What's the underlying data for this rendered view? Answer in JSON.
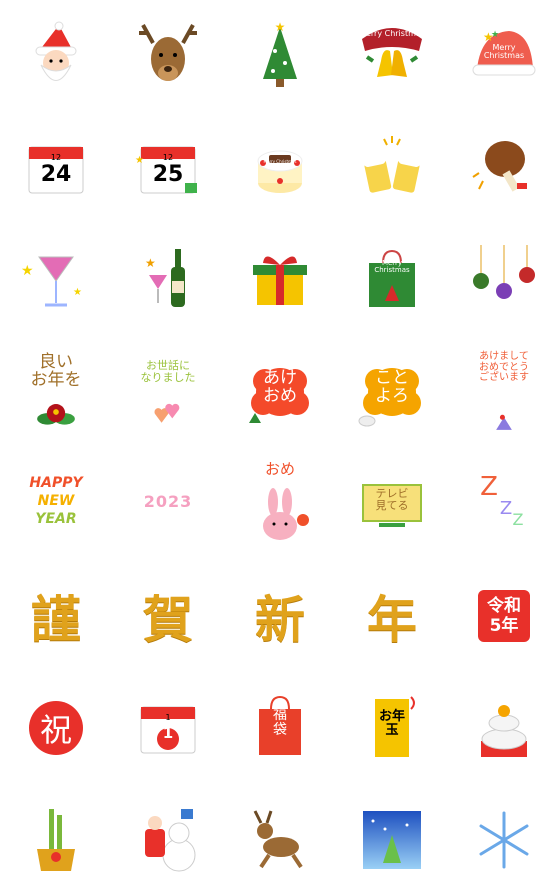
{
  "colors": {
    "red": "#e8302a",
    "gold": "#e0a21c",
    "green": "#2f8a34"
  },
  "stickers": {
    "r1": {
      "santa": "santa-icon",
      "reindeer": "reindeer-icon",
      "tree": "christmas-tree-icon",
      "bell_sign": "Merry Christmas",
      "santa_hat": "Merry Christmas"
    },
    "r2": {
      "cal24_month": "12",
      "cal24_day": "24",
      "cal25_month": "12",
      "cal25_day": "25",
      "cake": "Merry Christmas",
      "beer": "beer-toast-icon",
      "chicken": "chicken-leg-icon"
    },
    "r3": {
      "cocktail": "cocktail-icon",
      "wine": "wine-bottle-icon",
      "gift": "gift-box-icon",
      "bag": "Merry Christmas",
      "ornaments": "ornaments-icon"
    },
    "r4": {
      "yoi_otoshi": "良い\nお年を",
      "osewa": "お世話に\nなりました",
      "akeome": "あけ\nおめ",
      "kotoyoro": "こと\nよろ",
      "akemashite": "あけまして\nおめでとう\nございます"
    },
    "r5": {
      "happy": "HAPPY",
      "new": "NEW",
      "year": "YEAR",
      "year_num": "2023",
      "ome": "おめ",
      "tv": "テレビ\n見てる",
      "z1": "Z",
      "z2": "Z",
      "z3": "Z"
    },
    "r6": {
      "k1": "謹",
      "k2": "賀",
      "k3": "新",
      "k4": "年",
      "reiwa": "令和\n5年"
    },
    "r7": {
      "iwai": "祝",
      "cal1_month": "1",
      "cal1_day": "1",
      "fukubukuro": "福\n袋",
      "otoshidama": "お年\n玉",
      "kagami": "kagami-mochi-icon"
    },
    "r8": {
      "kadomatsu": "kadomatsu-icon",
      "santa_snowman": "santa-snowman-icon",
      "reindeer_run": "running-reindeer-icon",
      "snow_card": "snowy-tree-card-icon",
      "snowflake": "snowflake-icon"
    }
  }
}
